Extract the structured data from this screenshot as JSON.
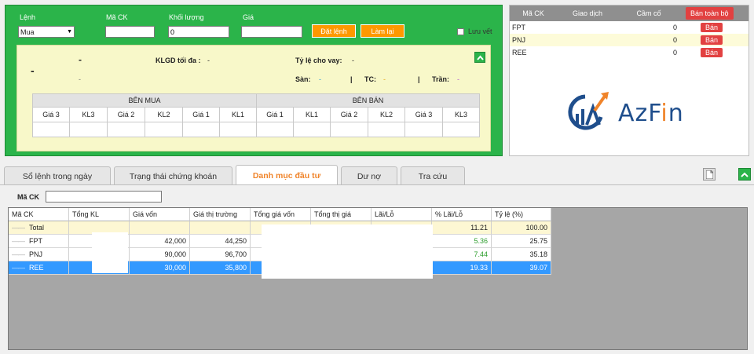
{
  "order": {
    "side_label": "Lệnh",
    "side_value": "Mua",
    "symbol_label": "Mã CK",
    "symbol_value": "",
    "qty_label": "Khối lượng",
    "qty_value": "0",
    "price_label": "Giá",
    "price_value": "",
    "place_button": "Đặt lệnh",
    "reset_button": "Làm lại",
    "save_label": "Lưu vết"
  },
  "info": {
    "symbol": "-",
    "name": "-",
    "name2": "-",
    "max_qty_label": "KLGD tối đa :",
    "max_qty_value": "-",
    "loan_label": "Tỷ lệ cho vay:",
    "loan_value": "-",
    "floor_label": "Sàn:",
    "floor_value": "-",
    "sep1": "|",
    "ref_label": "TC:",
    "ref_value": "-",
    "sep2": "|",
    "ceil_label": "Trần:",
    "ceil_value": "-",
    "collapse_icon": "chevron-up-icon"
  },
  "orderbook": {
    "buy_title": "BÊN MUA",
    "sell_title": "BÊN BÁN",
    "buy_cols": [
      "Giá 3",
      "KL3",
      "Giá 2",
      "KL2",
      "Giá 1",
      "KL1"
    ],
    "sell_cols": [
      "Giá 1",
      "KL1",
      "Giá 2",
      "KL2",
      "Giá 3",
      "KL3"
    ]
  },
  "stocks": {
    "headers": [
      "Mã CK",
      "Giao dịch",
      "Cầm cố"
    ],
    "sell_all": "Bán toàn bộ",
    "rows": [
      {
        "symbol": "FPT",
        "trade": "",
        "pledged": "0",
        "action": "Bán"
      },
      {
        "symbol": "PNJ",
        "trade": "",
        "pledged": "0",
        "action": "Bán"
      },
      {
        "symbol": "REE",
        "trade": "",
        "pledged": "0",
        "action": "Bán"
      }
    ],
    "logo_text_a": "AzF",
    "logo_text_i": "i",
    "logo_text_n": "n",
    "logo_color": "#1f4e8c",
    "logo_accent": "#f0842a"
  },
  "tabs": [
    {
      "label": "Sổ lệnh trong ngày"
    },
    {
      "label": "Trạng thái chứng khoán"
    },
    {
      "label": "Danh mục đầu tư"
    },
    {
      "label": "Dư nợ"
    },
    {
      "label": "Tra cứu"
    }
  ],
  "filter": {
    "label": "Mã CK",
    "value": ""
  },
  "portfolio": {
    "headers": [
      "Mã CK",
      "Tổng KL",
      "Giá vốn",
      "Giá thị trường",
      "Tổng giá vốn",
      "Tổng thị giá",
      "Lãi/Lỗ",
      "% Lãi/Lỗ",
      "Tỷ lệ (%)"
    ],
    "total": {
      "symbol": "Total",
      "pct": "11.21",
      "ratio": "100.00"
    },
    "rows": [
      {
        "symbol": "FPT",
        "cost": "42,000",
        "market": "44,250",
        "pct": "5.36",
        "ratio": "25.75"
      },
      {
        "symbol": "PNJ",
        "cost": "90,000",
        "market": "96,700",
        "pct": "7.44",
        "ratio": "35.18"
      },
      {
        "symbol": "REE",
        "cost": "30,000",
        "market": "35,800",
        "pct": "19.33",
        "ratio": "39.07"
      }
    ]
  }
}
